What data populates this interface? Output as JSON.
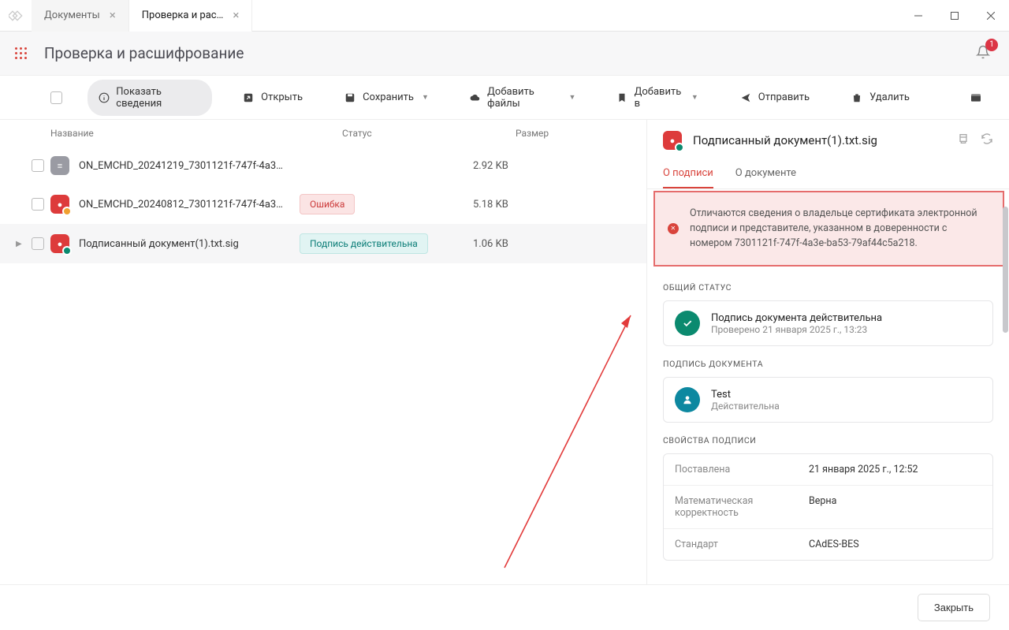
{
  "tabs": [
    {
      "label": "Документы"
    },
    {
      "label": "Проверка и рас…"
    }
  ],
  "page": {
    "title": "Проверка и расшифрование"
  },
  "notifications": {
    "count": "1"
  },
  "toolbar": {
    "show_info": "Показать сведения",
    "open": "Открыть",
    "save": "Сохранить",
    "add_files": "Добавить файлы",
    "add_to": "Добавить в",
    "send": "Отправить",
    "delete": "Удалить"
  },
  "list": {
    "headers": {
      "name": "Название",
      "status": "Статус",
      "size": "Размер"
    },
    "rows": [
      {
        "name": "ON_EMCHD_20241219_7301121f-747f-4a3…",
        "status": "",
        "size": "2.92 KB",
        "icon": "gray"
      },
      {
        "name": "ON_EMCHD_20240812_7301121f-747f-4a3…",
        "status": "Ошибка",
        "statusKind": "error",
        "size": "5.18 KB",
        "icon": "red",
        "badge": "warn"
      },
      {
        "name": "Подписанный документ(1).txt.sig",
        "status": "Подпись действительна",
        "statusKind": "valid",
        "size": "1.06 KB",
        "icon": "red",
        "badge": "ok"
      }
    ]
  },
  "detail": {
    "title": "Подписанный документ(1).txt.sig",
    "tabs": {
      "about_sign": "О подписи",
      "about_doc": "О документе"
    },
    "error": "Отличаются сведения о владельце сертификата электронной подписи и представителе, указанном в доверенности с номером 7301121f-747f-4a3e-ba53-79af44c5a218.",
    "overall_status": {
      "label": "ОБЩИЙ СТАТУС",
      "line1": "Подпись документа действительна",
      "line2": "Проверено 21 января 2025 г., 13:23"
    },
    "doc_sign": {
      "label": "ПОДПИСЬ ДОКУМЕНТА",
      "name": "Test",
      "status": "Действительна"
    },
    "props": {
      "label": "СВОЙСТВА ПОДПИСИ",
      "rows": [
        {
          "key": "Поставлена",
          "val": "21 января 2025 г., 12:52"
        },
        {
          "key": "Математическая корректность",
          "val": "Верна"
        },
        {
          "key": "Стандарт",
          "val": "CAdES-BES"
        }
      ]
    }
  },
  "footer": {
    "close": "Закрыть"
  }
}
